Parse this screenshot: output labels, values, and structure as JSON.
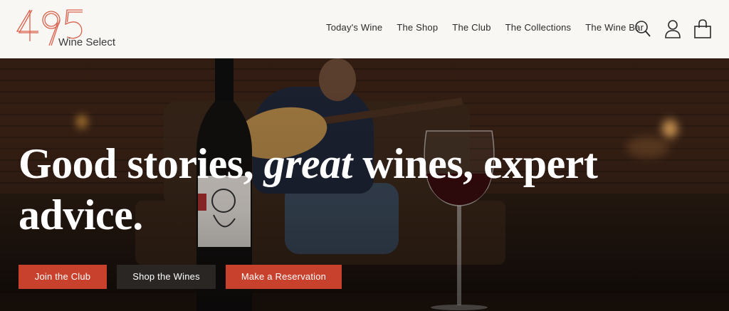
{
  "brand": {
    "logo_number": "495",
    "logo_text": "Wine Select",
    "accent_color": "#c8412c"
  },
  "nav": {
    "items": [
      {
        "label": "Today's Wine"
      },
      {
        "label": "The Shop"
      },
      {
        "label": "The Club"
      },
      {
        "label": "The Collections"
      },
      {
        "label": "The Wine Bar"
      }
    ],
    "icons": [
      "search-icon",
      "account-icon",
      "bag-icon"
    ]
  },
  "hero": {
    "headline_part1": "Good stories, ",
    "headline_em": "great",
    "headline_part2": " wines, expert advice.",
    "buttons": [
      {
        "label": "Join the Club",
        "style": "red"
      },
      {
        "label": "Shop the Wines",
        "style": "dark"
      },
      {
        "label": "Make a Reservation",
        "style": "red"
      }
    ]
  }
}
